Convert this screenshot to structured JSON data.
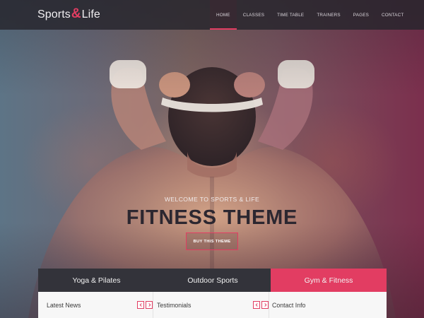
{
  "header": {
    "logo_part1": "Sports",
    "logo_amp": "&",
    "logo_part2": "Life",
    "nav": [
      "HOME",
      "CLASSES",
      "TIME TABLE",
      "TRAINERS",
      "PAGES",
      "CONTACT"
    ],
    "active_nav": "HOME"
  },
  "hero": {
    "welcome": "WELCOME TO SPORTS & LIFE",
    "headline": "FITNESS THEME",
    "cta": "BUY THIS THEME"
  },
  "tabs": {
    "items": [
      "Yoga & Pilates",
      "Outdoor Sports",
      "Gym & Fitness"
    ],
    "active": "Gym & Fitness"
  },
  "panels": {
    "news_title": "Latest News",
    "testimonials_title": "Testimonials",
    "contact_title": "Contact Info"
  },
  "colors": {
    "accent": "#e23d62",
    "dark": "#33333a",
    "panel_bg": "#f7f7f7"
  },
  "icons": {
    "prev": "chevron-left-icon",
    "next": "chevron-right-icon"
  }
}
